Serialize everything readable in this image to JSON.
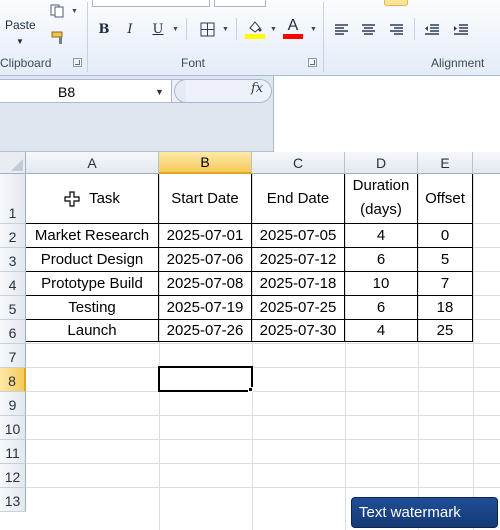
{
  "ribbon": {
    "clipboard": {
      "paste_label": "Paste",
      "group_label": "Clipboard"
    },
    "font": {
      "group_label": "Font",
      "bold": "B",
      "italic": "I",
      "underline": "U",
      "font_color_glyph": "A"
    },
    "alignment": {
      "group_label": "Alignment"
    },
    "colors": {
      "highlight": "#ffff00",
      "font_color": "#ff0000"
    }
  },
  "formula_bar": {
    "name_box": "B8",
    "fx_label": "fx",
    "formula": ""
  },
  "sheet": {
    "columns": [
      "A",
      "B",
      "C",
      "D",
      "E"
    ],
    "rows": [
      "1",
      "2",
      "3",
      "4",
      "5",
      "6",
      "7",
      "8",
      "9",
      "10",
      "11",
      "12",
      "13"
    ],
    "selected_column": "B",
    "selected_row": "8",
    "headers": {
      "task": "Task",
      "start": "Start Date",
      "end": "End Date",
      "duration_line1": "Duration",
      "duration_line2": "(days)",
      "offset": "Offset"
    },
    "data": [
      [
        "Market Research",
        "2025-07-01",
        "2025-07-05",
        "4",
        "0"
      ],
      [
        "Product Design",
        "2025-07-06",
        "2025-07-12",
        "6",
        "5"
      ],
      [
        "Prototype Build",
        "2025-07-08",
        "2025-07-18",
        "10",
        "7"
      ],
      [
        "Testing",
        "2025-07-19",
        "2025-07-25",
        "6",
        "18"
      ],
      [
        "Launch",
        "2025-07-26",
        "2025-07-30",
        "4",
        "25"
      ]
    ]
  },
  "watermark": "Text watermark"
}
